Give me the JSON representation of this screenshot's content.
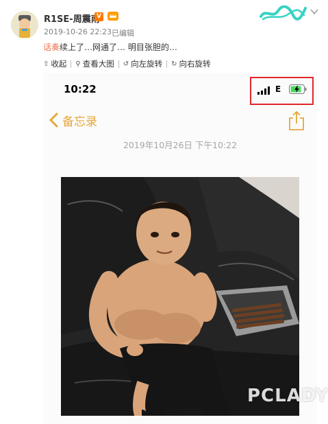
{
  "post": {
    "username": "R1SE-周震南",
    "verified_badge": "V",
    "timestamp": "2019-10-26 22:23",
    "edited": "已编辑",
    "text_topic": "话奏",
    "text_body": "续上了…网通了…  明目张胆的…"
  },
  "toolbar": {
    "collapse": "收起",
    "view_large": "查看大图",
    "rotate_left": "向左旋转",
    "rotate_right": "向右旋转"
  },
  "screenshot": {
    "status_time": "10:22",
    "network_type": "E",
    "back_label": "备忘录",
    "note_date": "2019年10月26日 下午10:22",
    "watermark": "PCLADY"
  },
  "colors": {
    "accent_yellow": "#e4a73b",
    "highlight_red": "#e0262b",
    "topic_orange": "#eb7350"
  }
}
